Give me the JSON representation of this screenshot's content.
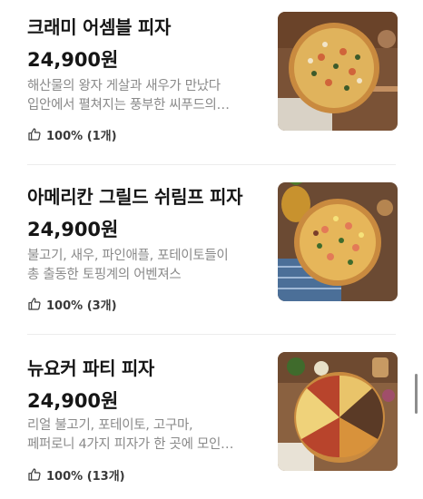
{
  "menu_items": [
    {
      "name": "크래미 어셈블 피자",
      "price": "24,900원",
      "desc_line1": "해산물의 왕자 게살과 새우가 만났다",
      "desc_line2": "입안에서 펼쳐지는 풍부한 씨푸드의…",
      "rating": "100% (1개)"
    },
    {
      "name": "아메리칸 그릴드 쉬림프 피자",
      "price": "24,900원",
      "desc_line1": "불고기, 새우, 파인애플, 포테이토들이",
      "desc_line2": "총 출동한 토핑계의 어벤져스",
      "rating": "100% (3개)"
    },
    {
      "name": "뉴요커 파티 피자",
      "price": "24,900원",
      "desc_line1": "리얼 불고기, 포테이토, 고구마,",
      "desc_line2": "페퍼로니 4가지 피자가 한 곳에 모인…",
      "rating": "100% (13개)"
    }
  ],
  "icons": {
    "rating": "thumbs-up-icon"
  },
  "colors": {
    "title": "#161616",
    "description": "#8a8a8a",
    "divider": "#ececec"
  }
}
